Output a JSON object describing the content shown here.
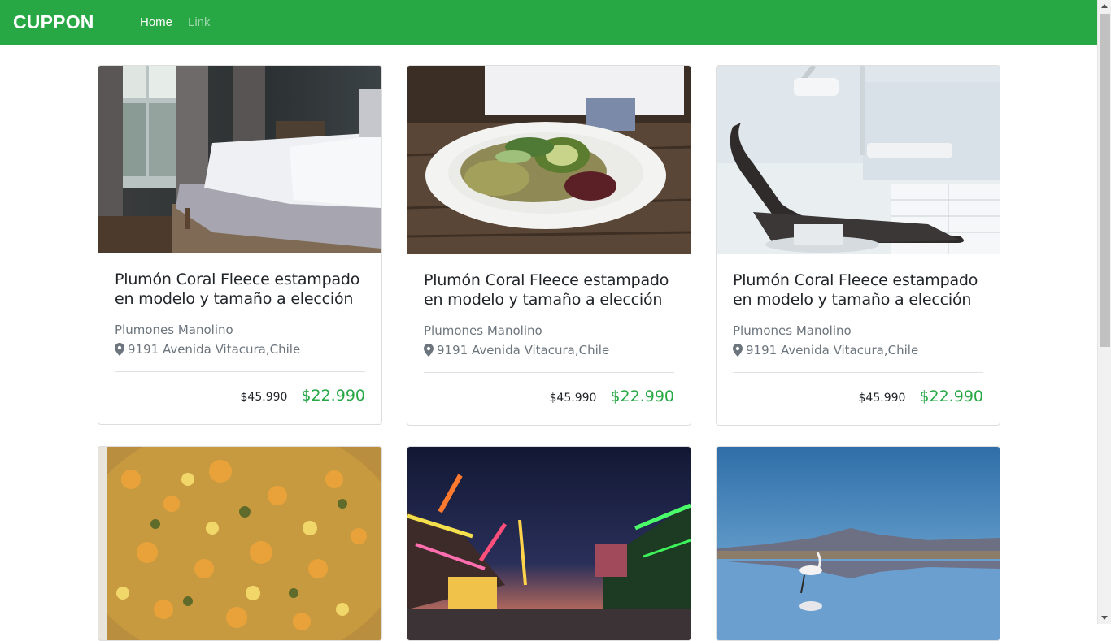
{
  "navbar": {
    "brand": "CUPPON",
    "items": [
      {
        "label": "Home"
      },
      {
        "label": "Link"
      }
    ],
    "color": "#28a745"
  },
  "cards": [
    {
      "image": "bedroom-photo",
      "title": "Plumón Coral Fleece estampado en modelo y tamaño a elección",
      "merchant": "Plumones Manolino",
      "address": "9191 Avenida Vitacura,Chile",
      "old_price": "$45.990",
      "new_price": "$22.990"
    },
    {
      "image": "salad-plate-photo",
      "title": "Plumón Coral Fleece estampado en modelo y tamaño a elección",
      "merchant": "Plumones Manolino",
      "address": "9191 Avenida Vitacura,Chile",
      "old_price": "$45.990",
      "new_price": "$22.990"
    },
    {
      "image": "dental-chair-photo",
      "title": "Plumón Coral Fleece estampado en modelo y tamaño a elección",
      "merchant": "Plumones Manolino",
      "address": "9191 Avenida Vitacura,Chile",
      "old_price": "$45.990",
      "new_price": "$22.990"
    },
    {
      "image": "vegetable-stew-photo"
    },
    {
      "image": "carnival-night-photo"
    },
    {
      "image": "flamingo-lake-photo"
    }
  ],
  "icons": {
    "location": "map-marker-icon"
  },
  "colors": {
    "accent": "#28a745",
    "muted": "#6c757d"
  }
}
